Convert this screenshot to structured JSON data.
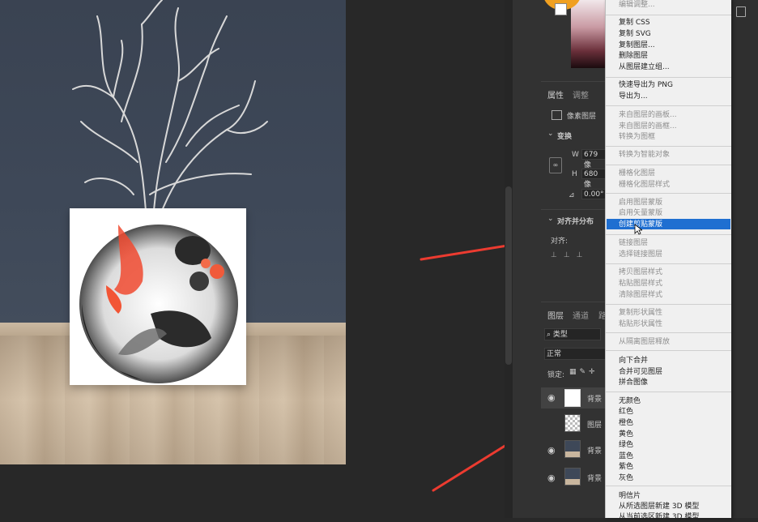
{
  "menu": {
    "items": [
      {
        "label": "编辑调整...",
        "enabled": false
      },
      {
        "label": "复制 CSS",
        "enabled": true
      },
      {
        "label": "复制 SVG",
        "enabled": true
      },
      {
        "label": "复制图层...",
        "enabled": true
      },
      {
        "label": "删除图层",
        "enabled": true
      },
      {
        "label": "从图层建立组...",
        "enabled": true
      },
      {
        "label": "快速导出为 PNG",
        "enabled": true
      },
      {
        "label": "导出为...",
        "enabled": true
      },
      {
        "label": "来自图层的画板...",
        "enabled": false
      },
      {
        "label": "来自图层的画框...",
        "enabled": false
      },
      {
        "label": "转换为图框",
        "enabled": false
      },
      {
        "label": "转换为智能对象",
        "enabled": true
      },
      {
        "label": "栅格化图层",
        "enabled": false
      },
      {
        "label": "栅格化图层样式",
        "enabled": false
      },
      {
        "label": "启用图层蒙版",
        "enabled": false
      },
      {
        "label": "启用矢量蒙版",
        "enabled": false
      },
      {
        "label": "创建剪贴蒙版",
        "enabled": true,
        "highlighted": true
      },
      {
        "label": "链接图层",
        "enabled": false
      },
      {
        "label": "选择链接图层",
        "enabled": false
      },
      {
        "label": "拷贝图层样式",
        "enabled": false
      },
      {
        "label": "粘贴图层样式",
        "enabled": false
      },
      {
        "label": "清除图层样式",
        "enabled": false
      },
      {
        "label": "复制形状属性",
        "enabled": false
      },
      {
        "label": "粘贴形状属性",
        "enabled": false
      },
      {
        "label": "从隔离图层释放",
        "enabled": false
      },
      {
        "label": "向下合并",
        "enabled": true
      },
      {
        "label": "合并可见图层",
        "enabled": true
      },
      {
        "label": "拼合图像",
        "enabled": true
      },
      {
        "label": "无颜色",
        "enabled": true
      },
      {
        "label": "红色",
        "enabled": true
      },
      {
        "label": "橙色",
        "enabled": true
      },
      {
        "label": "黄色",
        "enabled": true
      },
      {
        "label": "绿色",
        "enabled": true
      },
      {
        "label": "蓝色",
        "enabled": true
      },
      {
        "label": "紫色",
        "enabled": true
      },
      {
        "label": "灰色",
        "enabled": true
      },
      {
        "label": "明信片",
        "enabled": true
      },
      {
        "label": "从所选图层新建 3D 模型",
        "enabled": true
      },
      {
        "label": "从当前选区新建 3D 模型",
        "enabled": true
      }
    ]
  },
  "properties": {
    "tabs": [
      "属性",
      "调整"
    ],
    "layer_type": "像素图层",
    "transform_title": "变换",
    "w_label": "W",
    "w_value": "679 像",
    "h_label": "H",
    "h_value": "680 像",
    "angle_value": "0.00°",
    "align_title": "对齐并分布",
    "align_sub": "对齐:"
  },
  "layers": {
    "tabs": [
      "图层",
      "通道",
      "路"
    ],
    "filter_label": "类型",
    "blend_mode": "正常",
    "lock_label": "锁定:",
    "rows": [
      {
        "name": "背景",
        "visible": true,
        "thumb": "vase-art"
      },
      {
        "name": "图层",
        "visible": false,
        "thumb": "transparent"
      },
      {
        "name": "背景",
        "visible": true,
        "thumb": "room"
      },
      {
        "name": "背景",
        "visible": true,
        "thumb": "room"
      }
    ]
  },
  "colors": {
    "highlight": "#1f6fd1",
    "arrow": "#ec3b30",
    "panel_bg": "#323232"
  }
}
